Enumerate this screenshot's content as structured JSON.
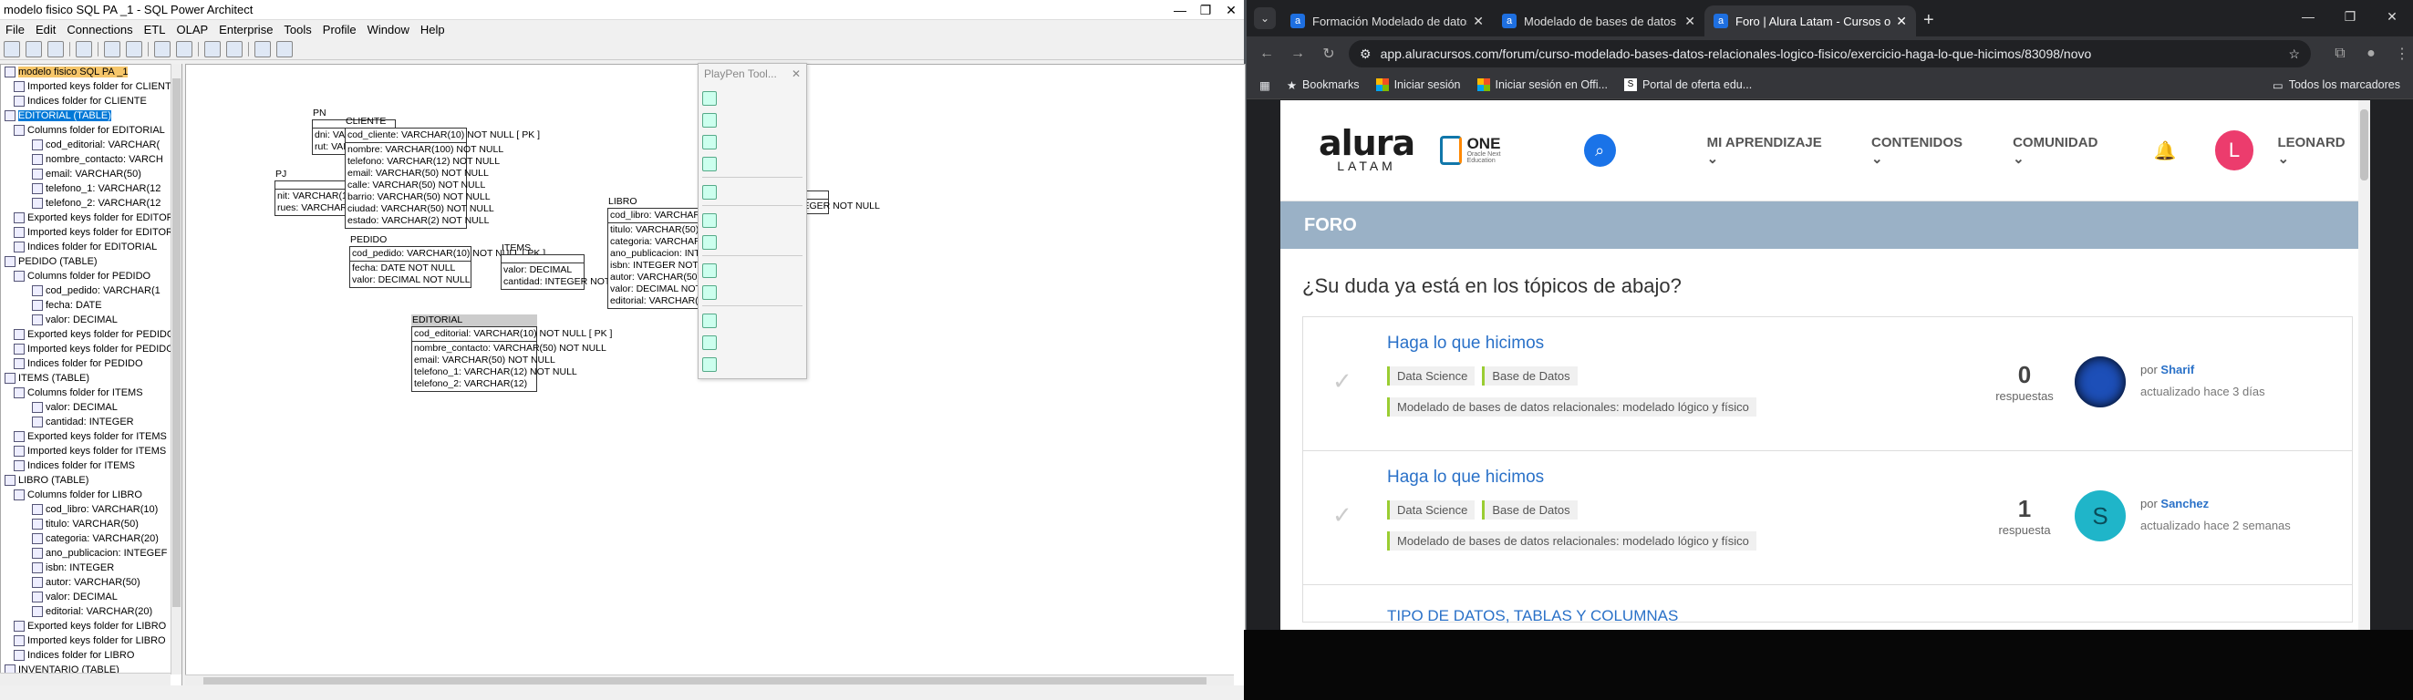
{
  "spa": {
    "title": "modelo fisico SQL PA _1 - SQL Power Architect",
    "winbtns": [
      "—",
      "❐",
      "✕"
    ],
    "menu": [
      "File",
      "Edit",
      "Connections",
      "ETL",
      "OLAP",
      "Enterprise",
      "Tools",
      "Profile",
      "Window",
      "Help"
    ],
    "tree": [
      {
        "text": "modelo fisico SQL PA _1",
        "style": "top",
        "indent": 0
      },
      {
        "text": "Imported keys folder for CLIENTE",
        "indent": 1
      },
      {
        "text": "Indices folder for CLIENTE",
        "indent": 1
      },
      {
        "text": "EDITORIAL (TABLE)",
        "style": "sel",
        "indent": 0
      },
      {
        "text": "Columns folder for EDITORIAL",
        "indent": 1
      },
      {
        "text": "cod_editorial: VARCHAR(",
        "indent": 3
      },
      {
        "text": "nombre_contacto: VARCH",
        "indent": 3
      },
      {
        "text": "email: VARCHAR(50)",
        "indent": 3
      },
      {
        "text": "telefono_1: VARCHAR(12",
        "indent": 3
      },
      {
        "text": "telefono_2: VARCHAR(12",
        "indent": 3
      },
      {
        "text": "Exported keys folder for EDITORI",
        "indent": 1
      },
      {
        "text": "Imported keys folder for EDITORI",
        "indent": 1
      },
      {
        "text": "Indices folder for EDITORIAL",
        "indent": 1
      },
      {
        "text": "PEDIDO (TABLE)",
        "indent": 0
      },
      {
        "text": "Columns folder for PEDIDO",
        "indent": 1
      },
      {
        "text": "cod_pedido: VARCHAR(1",
        "indent": 3
      },
      {
        "text": "fecha: DATE",
        "indent": 3
      },
      {
        "text": "valor: DECIMAL",
        "indent": 3
      },
      {
        "text": "Exported keys folder for PEDIDO",
        "indent": 1
      },
      {
        "text": "Imported keys folder for PEDIDO",
        "indent": 1
      },
      {
        "text": "Indices folder for PEDIDO",
        "indent": 1
      },
      {
        "text": "ITEMS (TABLE)",
        "indent": 0
      },
      {
        "text": "Columns folder for ITEMS",
        "indent": 1
      },
      {
        "text": "valor: DECIMAL",
        "indent": 3
      },
      {
        "text": "cantidad: INTEGER",
        "indent": 3
      },
      {
        "text": "Exported keys folder for ITEMS",
        "indent": 1
      },
      {
        "text": "Imported keys folder for ITEMS",
        "indent": 1
      },
      {
        "text": "Indices folder for ITEMS",
        "indent": 1
      },
      {
        "text": "LIBRO (TABLE)",
        "indent": 0
      },
      {
        "text": "Columns folder for LIBRO",
        "indent": 1
      },
      {
        "text": "cod_libro: VARCHAR(10)",
        "indent": 3
      },
      {
        "text": "titulo: VARCHAR(50)",
        "indent": 3
      },
      {
        "text": "categoria: VARCHAR(20)",
        "indent": 3
      },
      {
        "text": "ano_publicacion: INTEGEF",
        "indent": 3
      },
      {
        "text": "isbn: INTEGER",
        "indent": 3
      },
      {
        "text": "autor: VARCHAR(50)",
        "indent": 3
      },
      {
        "text": "valor: DECIMAL",
        "indent": 3
      },
      {
        "text": "editorial: VARCHAR(20)",
        "indent": 3
      },
      {
        "text": "Exported keys folder for LIBRO",
        "indent": 1
      },
      {
        "text": "Imported keys folder for LIBRO",
        "indent": 1
      },
      {
        "text": "Indices folder for LIBRO",
        "indent": 1
      },
      {
        "text": "INVENTARIO (TABLE)",
        "indent": 0
      }
    ],
    "playpen_title": "PlayPen Tool...",
    "tables": [
      {
        "name": "PN",
        "sections": [
          [],
          [
            "dni: VARCHAR(12)   NOT NULL",
            "rut: VARCHAR(9)   NOT NULL"
          ]
        ]
      },
      {
        "name": "PJ",
        "sections": [
          [],
          [
            "nit: VARCHAR(12)   NOT NULL",
            "rues: VARCHAR(12)   NOT NULL"
          ]
        ]
      },
      {
        "name": "CLIENTE",
        "sections": [
          [
            "cod_cliente: VARCHAR(10)   NOT NULL  [ PK ]"
          ],
          [
            "nombre: VARCHAR(100)   NOT NULL",
            "telefono: VARCHAR(12)   NOT NULL",
            "email: VARCHAR(50)   NOT NULL",
            "calle: VARCHAR(50)   NOT NULL",
            "barrio: VARCHAR(50)   NOT NULL",
            "ciudad: VARCHAR(50)   NOT NULL",
            "estado: VARCHAR(2)   NOT NULL"
          ]
        ]
      },
      {
        "name": "PEDIDO",
        "sections": [
          [
            "cod_pedido: VARCHAR(10)   NOT NULL  [ PK ]"
          ],
          [
            "fecha: DATE   NOT NULL",
            "valor: DECIMAL   NOT NULL"
          ]
        ]
      },
      {
        "name": "ITEMS",
        "sections": [
          [],
          [
            "valor: DECIMAL",
            "cantidad: INTEGER   NOT NULL"
          ]
        ]
      },
      {
        "name": "LIBRO",
        "sections": [
          [
            "cod_libro: VARCHAR(10)   NOT NULL  [ PK ]"
          ],
          [
            "titulo: VARCHAR(50)   NOT NULL",
            "categoria: VARCHAR(20)   NOT NULL",
            "ano_publicacion: INTEGER   NOT NULL",
            "isbn: INTEGER   NOT NULL",
            "autor: VARCHAR(50)   NOT NULL",
            "valor: DECIMAL   NOT NULL",
            "editorial: VARCHAR(20)   NOT NULL"
          ]
        ]
      },
      {
        "name": "INVENTARIO",
        "sections": [
          [],
          [
            "cantidad: INTEGER   NOT NULL"
          ]
        ]
      },
      {
        "name": "EDITORIAL",
        "sections": [
          [
            "cod_editorial: VARCHAR(10)   NOT NULL  [ PK ]"
          ],
          [
            "nombre_contacto: VARCHAR(50)   NOT NULL",
            "email: VARCHAR(50)   NOT NULL",
            "telefono_1: VARCHAR(12)   NOT NULL",
            "telefono_2: VARCHAR(12)"
          ]
        ]
      }
    ]
  },
  "chrome": {
    "tabs": [
      {
        "title": "Formación Modelado de datos"
      },
      {
        "title": "Modelado de bases de datos r"
      },
      {
        "title": "Foro | Alura Latam - Cursos onl",
        "active": true
      }
    ],
    "url": "app.aluracursos.com/forum/curso-modelado-bases-datos-relacionales-logico-fisico/exercicio-haga-lo-que-hicimos/83098/novo",
    "bookmarks": [
      "Bookmarks",
      "Iniciar sesión",
      "Iniciar sesión en Offi...",
      "Portal de oferta edu..."
    ],
    "all_bookmarks": "Todos los marcadores"
  },
  "alura": {
    "logo": "alura",
    "logo_sub": "LATAM",
    "one": "ONE",
    "one_sub": "Oracle Next Education",
    "menu": [
      "MI APRENDIZAJE",
      "CONTENIDOS",
      "COMUNIDAD"
    ],
    "avatar_letter": "L",
    "username": "LEONARD",
    "section": "FORO",
    "question": "¿Su duda ya está en los tópicos de abajo?",
    "topics": [
      {
        "title": "Haga lo que hicimos",
        "tags": [
          "Data Science",
          "Base de Datos"
        ],
        "course": "Modelado de bases de datos relacionales: modelado lógico y físico",
        "count": "0",
        "count_label": "respuestas",
        "by_prefix": "por",
        "author": "Sharif",
        "updated": "actualizado hace 3 días",
        "avatar_color": "#1d4fb8"
      },
      {
        "title": "Haga lo que hicimos",
        "tags": [
          "Data Science",
          "Base de Datos"
        ],
        "course": "Modelado de bases de datos relacionales: modelado lógico y físico",
        "count": "1",
        "count_label": "respuesta",
        "by_prefix": "por",
        "author": "Sanchez",
        "updated": "actualizado hace 2 semanas",
        "avatar_color": "#1fb5c9",
        "avatar_letter": "S"
      },
      {
        "title": "TIPO DE DATOS, TABLAS Y COLUMNAS"
      }
    ]
  }
}
